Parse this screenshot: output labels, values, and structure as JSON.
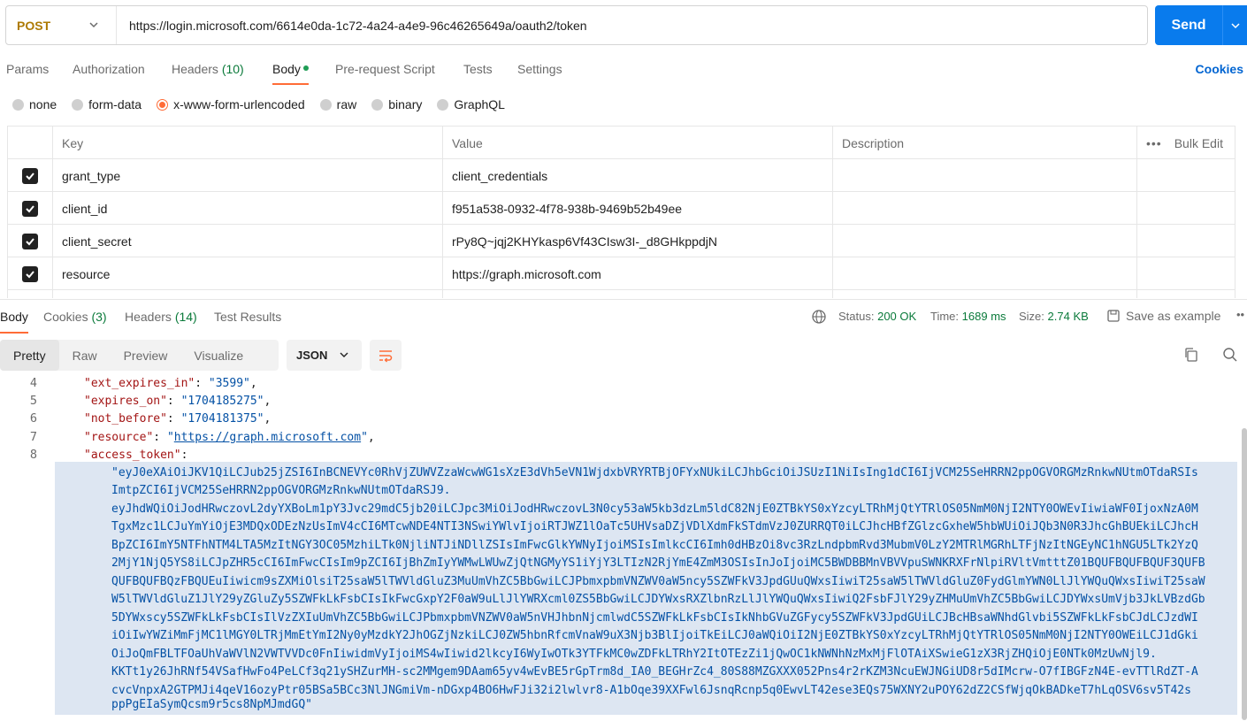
{
  "request": {
    "method": "POST",
    "url": "https://login.microsoft.com/6614e0da-1c72-4a24-a4e9-96c46265649a/oauth2/token",
    "send_label": "Send"
  },
  "req_tabs": {
    "params": "Params",
    "authorization": "Authorization",
    "headers": "Headers",
    "headers_count": "(10)",
    "body": "Body",
    "pre_request": "Pre-request Script",
    "tests": "Tests",
    "settings": "Settings",
    "cookies": "Cookies"
  },
  "body_types": {
    "none": "none",
    "form_data": "form-data",
    "urlencoded": "x-www-form-urlencoded",
    "raw": "raw",
    "binary": "binary",
    "graphql": "GraphQL",
    "selected": "x-www-form-urlencoded"
  },
  "params_table": {
    "headers": {
      "key": "Key",
      "value": "Value",
      "description": "Description",
      "bulk_edit": "Bulk Edit"
    },
    "rows": [
      {
        "key": "grant_type",
        "value": "client_credentials",
        "checked": true
      },
      {
        "key": "client_id",
        "value": "f951a538-0932-4f78-938b-9469b52b49ee",
        "checked": true
      },
      {
        "key": "client_secret",
        "value": "rPy8Q~jqj2KHYkasp6Vf43CIsw3I-_d8GHkppdjN",
        "checked": true
      },
      {
        "key": "resource",
        "value": "https://graph.microsoft.com",
        "checked": true
      }
    ]
  },
  "response": {
    "tabs": {
      "body": "Body",
      "cookies": "Cookies",
      "cookies_count": "(3)",
      "headers": "Headers",
      "headers_count": "(14)",
      "test_results": "Test Results"
    },
    "status_label": "Status:",
    "status_value": "200 OK",
    "time_label": "Time:",
    "time_value": "1689 ms",
    "size_label": "Size:",
    "size_value": "2.74 KB",
    "save_example": "Save as example",
    "views": {
      "pretty": "Pretty",
      "raw": "Raw",
      "preview": "Preview",
      "visualize": "Visualize"
    },
    "format": "JSON"
  },
  "code": {
    "line_numbers": [
      "4",
      "5",
      "6",
      "7",
      "8"
    ],
    "lines": [
      {
        "key": "\"ext_expires_in\"",
        "value": "\"3599\""
      },
      {
        "key": "\"expires_on\"",
        "value": "\"1704185275\""
      },
      {
        "key": "\"not_before\"",
        "value": "\"1704181375\""
      },
      {
        "key": "\"resource\"",
        "value": "https://graph.microsoft.com"
      },
      {
        "key": "\"access_token\""
      }
    ],
    "token_lines": [
      "\"eyJ0eXAiOiJKV1QiLCJub25jZSI6InBCNEVYc0RhVjZUWVZzaWcwWG1sXzE3dVh5eVN1WjdxbVRYRTBjOFYxNUkiLCJhbGciOiJSUzI1NiIsIng1dCI6IjVCM25SeHRRN2ppOGVORGMzRnkwNUtmOTdaRSIs",
      "ImtpZCI6IjVCM25SeHRRN2ppOGVORGMzRnkwNUtmOTdaRSJ9.",
      "eyJhdWQiOiJodHRwczovL2dyYXBoLm1pY3Jvc29mdC5jb20iLCJpc3MiOiJodHRwczovL3N0cy53aW5kb3dzLm5ldC82NjE0ZTBkYS0xYzcyLTRhMjQtYTRlOS05NmM0NjI2NTY0OWEvIiwiaWF0IjoxNzA0M",
      "TgxMzc1LCJuYmYiOjE3MDQxODEzNzUsImV4cCI6MTcwNDE4NTI3NSwiYWlvIjoiRTJWZ1lOaTc5UHVsaDZjVDlXdmFkSTdmVzJ0ZURRQT0iLCJhcHBfZGlzcGxheW5hbWUiOiJQb3N0R3JhcGhBUEkiLCJhcH",
      "BpZCI6ImY5NTFhNTM4LTA5MzItNGY3OC05MzhiLTk0NjliNTJiNDllZSIsImFwcGlkYWNyIjoiMSIsImlkcCI6Imh0dHBzOi8vc3RzLndpbmRvd3MubmV0LzY2MTRlMGRhLTFjNzItNGEyNC1hNGU5LTk2YzQ",
      "2MjY1NjQ5YS8iLCJpZHR5cCI6ImFwcCIsIm9pZCI6IjBhZmIyYWMwLWUwZjQtNGMyYS1iYjY3LTIzN2RjYmE4ZmM3OSIsInJoIjoiMC5BWDBBMnVBVVpuSWNKRXFrNlpiRVltVmtttZ01BQUFBQUFBQUF3QUFB",
      "QUFBQUFBQzFBQUEuIiwicm9sZXMiOlsiT25saW5lTWVldGluZ3MuUmVhZC5BbGwiLCJPbmxpbmVNZWV0aW5ncy5SZWFkV3JpdGUuQWxsIiwiT25saW5lTWVldGluZ0FydGlmYWN0LlJlYWQuQWxsIiwiT25saW",
      "W5lTWVldGluZ1JlY29yZGluZy5SZWFkLkFsbCIsIkFwcGxpY2F0aW9uLlJlYWRXcml0ZS5BbGwiLCJDYWxsRXZlbnRzLlJlYWQuQWxsIiwiQ2FsbFJlY29yZHMuUmVhZC5BbGwiLCJDYWxsUmVjb3JkLVBzdGb",
      "5DYWxscy5SZWFkLkFsbCIsIlVzZXIuUmVhZC5BbGwiLCJPbmxpbmVNZWV0aW5nVHJhbnNjcmlwdC5SZWFkLkFsbCIsIkNhbGVuZGFycy5SZWFkV3JpdGUiLCJBcHBsaWNhdGlvbi5SZWFkLkFsbCJdLCJzdWI",
      "iOiIwYWZiMmFjMC1lMGY0LTRjMmEtYmI2Ny0yMzdkY2JhOGZjNzkiLCJ0ZW5hbnRfcmVnaW9uX3Njb3BlIjoiTkEiLCJ0aWQiOiI2NjE0ZTBkYS0xYzcyLTRhMjQtYTRlOS05NmM0NjI2NTY0OWEiLCJ1dGki",
      "OiJoQmFBLTFOaUhVaWVlN2VWTVVDc0FnIiwidmVyIjoiMS4wIiwid2lkcyI6WyIwOTk3YTFkMC0wZDFkLTRhY2ItOTEzZi1jQwOC1kNWNhNzMxMjFlOTAiXSwieG1zX3RjZHQiOjE0NTk0MzUwNjl9.",
      "KKTt1y26JhRNf54VSafHwFo4PeLCf3q21ySHZurMH-sc2MMgem9DAam65yv4wEvBE5rGpTrm8d_IA0_BEGHrZc4_80S88MZGXXX052Pns4r2rKZM3NcuEWJNGiUD8r5dIMcrw-O7fIBGFzN4E-evTTlRdZT-A",
      "cvcVnpxA2GTPMJi4qeV16ozyPtr05BSa5BCc3NlJNGmiVm-nDGxp4BO6HwFJi32i2lwlvr8-A1bOqe39XXFwl6JsnqRcnp5q0EwvLT42ese3EQs75WXNY2uPOY62dZ2CSfWjqOkBADkeT7hLqOSV6sv5T42s",
      "ppPgEIaSymQcsm9r5cs8NpMJmdGQ\""
    ]
  },
  "colors": {
    "accent": "#ff6c37",
    "send": "#097bed",
    "method": "#ad7a03",
    "status_ok": "#0a7a3a",
    "selection": "#dde6f2"
  }
}
